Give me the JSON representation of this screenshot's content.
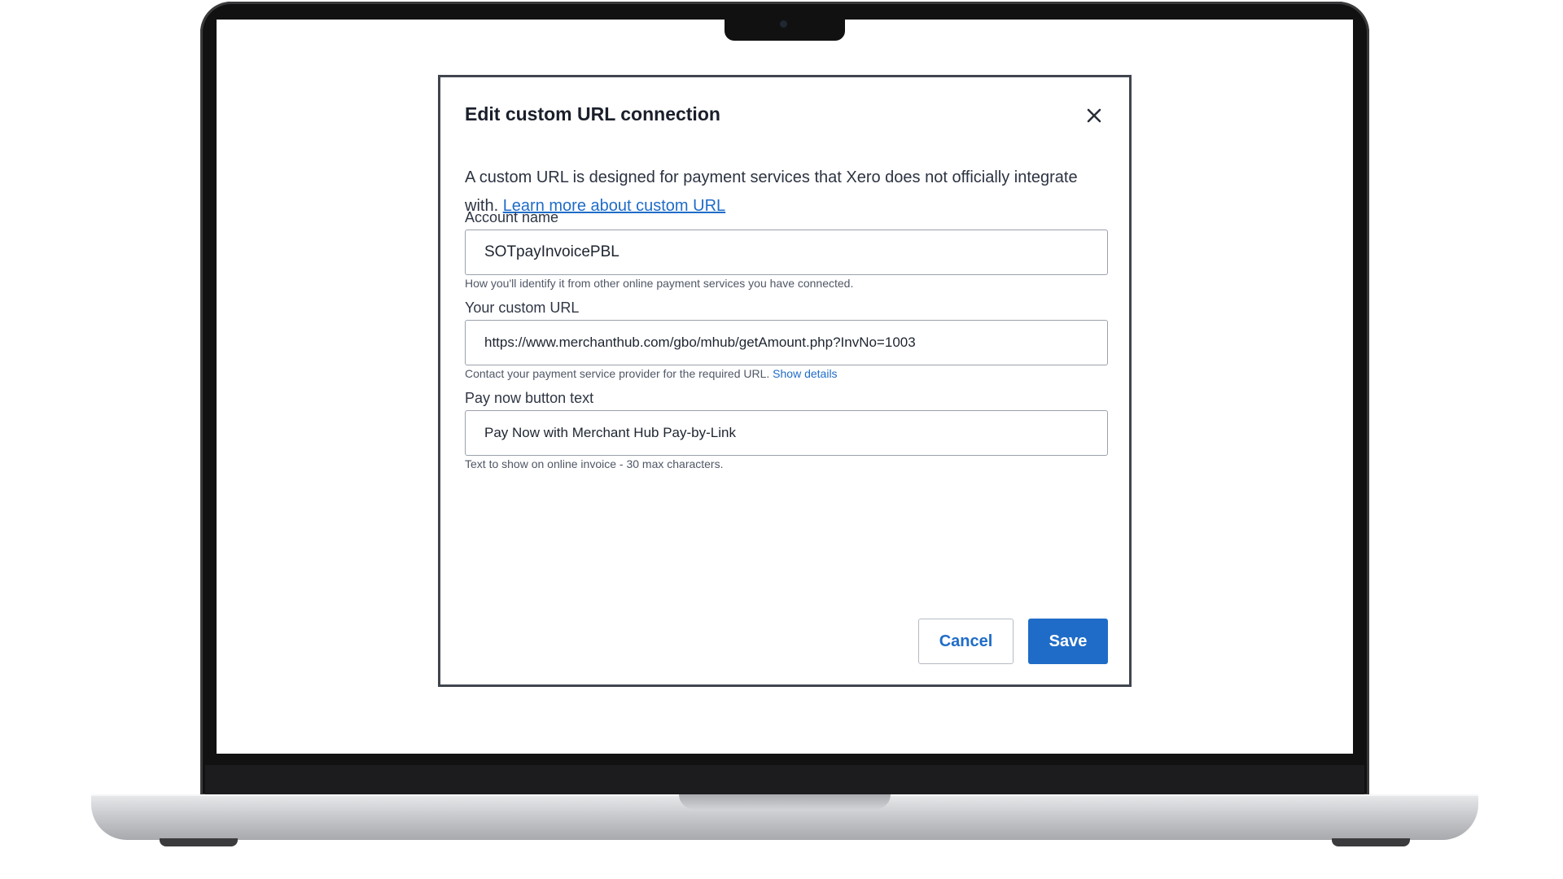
{
  "modal": {
    "title": "Edit custom URL connection",
    "description": "A custom URL is designed for payment services that Xero does not officially integrate with.",
    "learn_more_link": "Learn more about custom URL",
    "account_name": {
      "label": "Account name",
      "value": "SOTpayInvoicePBL",
      "helper": "How you'll identify it from other online payment services you have connected."
    },
    "custom_url": {
      "label": "Your custom URL",
      "value": "https://www.merchanthub.com/gbo/mhub/getAmount.php?InvNo=1003",
      "helper": "Contact your payment service provider for the required URL.",
      "helper_link": "Show details"
    },
    "pay_now_text": {
      "label": "Pay now button text",
      "value": "Pay Now with Merchant Hub Pay-by-Link",
      "helper": "Text to show on online invoice - 30 max characters."
    },
    "cancel_label": "Cancel",
    "save_label": "Save"
  },
  "icons": {
    "close": "close-icon"
  },
  "colors": {
    "accent": "#1f6cc8",
    "modal_border": "#40454f",
    "text": "#1e2430"
  }
}
